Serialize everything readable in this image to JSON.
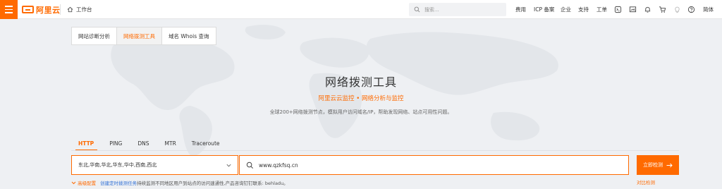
{
  "topbar": {
    "logo_text": "阿里云",
    "workbench_label": "工作台",
    "search_placeholder": "搜索...",
    "nav": {
      "fees": "费用",
      "icp": "ICP 备案",
      "enterprise": "企业",
      "support": "支持",
      "ticket": "工单",
      "language": "简体"
    },
    "icons": [
      "menu-icon",
      "home-icon",
      "search-icon",
      "terminal-icon",
      "screen-icon",
      "bell-icon",
      "cart-icon",
      "lightbulb-icon",
      "help-icon"
    ]
  },
  "tool_tabs": [
    {
      "label": "网站诊断分析",
      "active": false
    },
    {
      "label": "网络拨测工具",
      "active": true
    },
    {
      "label": "域名 Whois 查询",
      "active": false
    }
  ],
  "hero": {
    "title": "网络拨测工具",
    "subtitle": "阿里云云监控 • 网络分析与监控",
    "description": "全球200+网络拨测节点，模拟用户访问域名/IP，帮助发现网络、站点可用性问题。"
  },
  "protocol_tabs": [
    {
      "label": "HTTP",
      "active": true
    },
    {
      "label": "PING",
      "active": false
    },
    {
      "label": "DNS",
      "active": false
    },
    {
      "label": "MTR",
      "active": false
    },
    {
      "label": "Traceroute",
      "active": false
    }
  ],
  "query": {
    "region_value": "东北,华南,华北,华东,华中,西南,西北",
    "url_value": "www.qzkfsq.cn",
    "submit_label": "立即检测"
  },
  "footer": {
    "advanced": "高级配置",
    "create_task": "创建定时拨测任务",
    "note": "持续监测不同地区用户到站点的访问速通性,产品咨询钉钉联系: behladu。",
    "compare": "对比检测"
  },
  "colors": {
    "accent": "#ff6a00",
    "link": "#2f6fd6"
  }
}
